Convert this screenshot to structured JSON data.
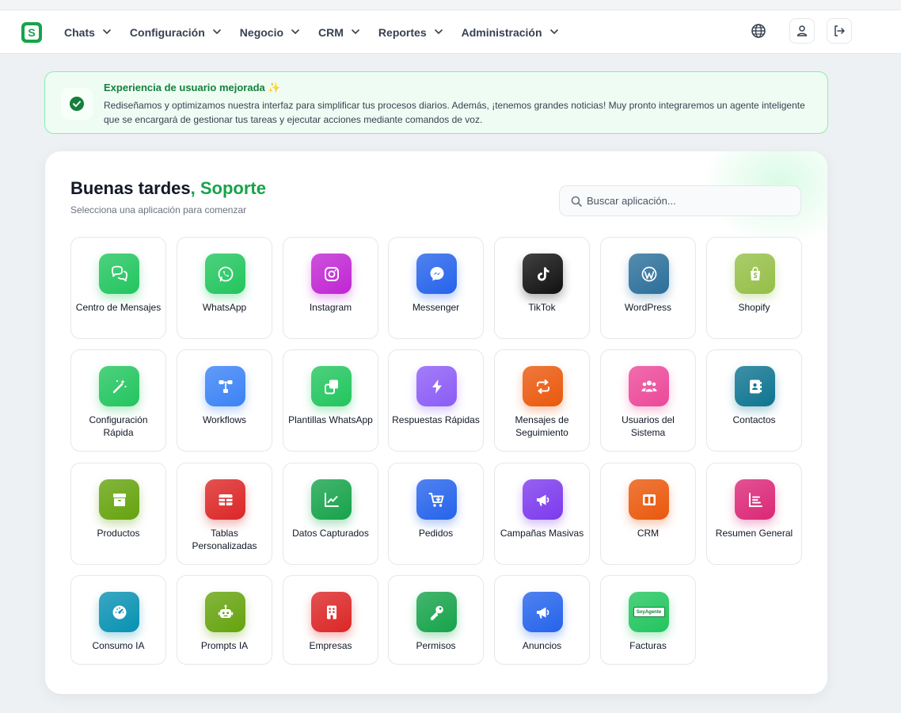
{
  "navbar": {
    "logo_letter": "S",
    "menu": [
      {
        "label": "Chats"
      },
      {
        "label": "Configuración"
      },
      {
        "label": "Negocio"
      },
      {
        "label": "CRM"
      },
      {
        "label": "Reportes"
      },
      {
        "label": "Administración"
      }
    ]
  },
  "notice": {
    "title": "Experiencia de usuario mejorada ✨",
    "body": "Rediseñamos y optimizamos nuestra interfaz para simplificar tus procesos diarios. Además, ¡tenemos grandes noticias! Muy pronto integraremos un agente inteligente que se encargará de gestionar tus tareas y ejecutar acciones mediante comandos de voz."
  },
  "main": {
    "greeting": "Buenas tardes",
    "user_name": ", Soporte",
    "subtitle": "Selecciona una aplicación para comenzar",
    "search_placeholder": "Buscar aplicación..."
  },
  "colors": {
    "brand": "#16a34a",
    "notice_bg": "#effcf3",
    "notice_border": "#86efac"
  },
  "apps": [
    {
      "label": "Centro de Mensajes",
      "icon": "chat-bubbles-icon",
      "color": "#22c55e"
    },
    {
      "label": "WhatsApp",
      "icon": "whatsapp-icon",
      "color": "#22c55e"
    },
    {
      "label": "Instagram",
      "icon": "instagram-icon",
      "color": "#c026d3"
    },
    {
      "label": "Messenger",
      "icon": "messenger-icon",
      "color": "#2563eb"
    },
    {
      "label": "TikTok",
      "icon": "tiktok-icon",
      "color": "#111111"
    },
    {
      "label": "WordPress",
      "icon": "wordpress-icon",
      "color": "#2b6f9a"
    },
    {
      "label": "Shopify",
      "icon": "shopify-icon",
      "color": "#95bf47"
    },
    {
      "label": "Configuración Rápida",
      "icon": "magic-wand-icon",
      "color": "#22c55e"
    },
    {
      "label": "Workflows",
      "icon": "workflow-icon",
      "color": "#3b82f6"
    },
    {
      "label": "Plantillas WhatsApp",
      "icon": "copy-icon",
      "color": "#22c55e"
    },
    {
      "label": "Respuestas Rápidas",
      "icon": "bolt-icon",
      "color": "#8b5cf6"
    },
    {
      "label": "Mensajes de Seguimiento",
      "icon": "repeat-icon",
      "color": "#ea580c"
    },
    {
      "label": "Usuarios del Sistema",
      "icon": "users-icon",
      "color": "#ec4899"
    },
    {
      "label": "Contactos",
      "icon": "address-book-icon",
      "color": "#0e7490"
    },
    {
      "label": "Productos",
      "icon": "box-icon",
      "color": "#65a30d"
    },
    {
      "label": "Tablas Personalizadas",
      "icon": "table-icon",
      "color": "#dc2626"
    },
    {
      "label": "Datos Capturados",
      "icon": "chart-line-icon",
      "color": "#16a34a"
    },
    {
      "label": "Pedidos",
      "icon": "cart-icon",
      "color": "#2563eb"
    },
    {
      "label": "Campañas Masivas",
      "icon": "megaphone-icon",
      "color": "#7c3aed"
    },
    {
      "label": "CRM",
      "icon": "columns-icon",
      "color": "#ea580c"
    },
    {
      "label": "Resumen General",
      "icon": "list-chart-icon",
      "color": "#db2777"
    },
    {
      "label": "Consumo IA",
      "icon": "gauge-icon",
      "color": "#0891b2"
    },
    {
      "label": "Prompts IA",
      "icon": "robot-icon",
      "color": "#65a30d"
    },
    {
      "label": "Empresas",
      "icon": "building-icon",
      "color": "#dc2626"
    },
    {
      "label": "Permisos",
      "icon": "key-icon",
      "color": "#16a34a"
    },
    {
      "label": "Anuncios",
      "icon": "megaphone-icon",
      "color": "#2563eb"
    },
    {
      "label": "Facturas",
      "icon": "invoice-icon",
      "color": "#22c55e",
      "badge_text": "SoyAgente"
    }
  ]
}
